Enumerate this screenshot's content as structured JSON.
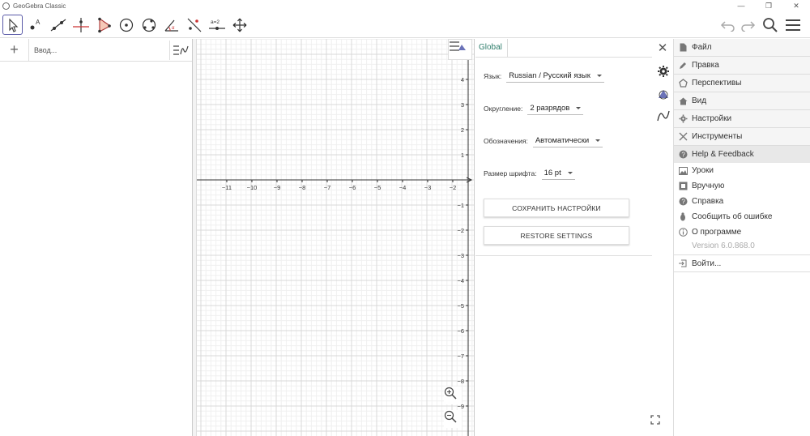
{
  "window": {
    "title": "GeoGebra Classic",
    "controls": [
      "—",
      "❐",
      "✕"
    ]
  },
  "algebra": {
    "placeholder": "Ввод..."
  },
  "graphics": {
    "x_ticks": [
      "-11",
      "-10",
      "-9",
      "-8",
      "-7",
      "-6",
      "-5",
      "-4",
      "-3",
      "-2"
    ],
    "y_ticks": [
      "4",
      "3",
      "2",
      "1",
      "-1",
      "-2",
      "-3",
      "-4",
      "-5",
      "-6",
      "-7",
      "-8",
      "-9"
    ]
  },
  "settings": {
    "tab": "Global",
    "language_label": "Язык:",
    "language_value": "Russian / Русский язык",
    "rounding_label": "Округление:",
    "rounding_value": "2 разрядов",
    "labeling_label": "Обозначения:",
    "labeling_value": "Автоматически",
    "fontsize_label": "Размер шрифта:",
    "fontsize_value": "16 pt",
    "save_button": "СОХРАНИТЬ НАСТРОЙКИ",
    "restore_button": "RESTORE SETTINGS"
  },
  "menu": {
    "items": [
      {
        "label": "Файл",
        "icon": "file-icon"
      },
      {
        "label": "Правка",
        "icon": "pencil-icon"
      },
      {
        "label": "Перспективы",
        "icon": "perspectives-icon"
      },
      {
        "label": "Вид",
        "icon": "home-icon"
      },
      {
        "label": "Настройки",
        "icon": "gear-icon"
      },
      {
        "label": "Инструменты",
        "icon": "tools-icon"
      },
      {
        "label": "Help & Feedback",
        "icon": "help-icon"
      }
    ],
    "help_items": [
      {
        "label": "Уроки",
        "icon": "image-icon"
      },
      {
        "label": "Вручную",
        "icon": "manual-icon"
      },
      {
        "label": "Справка",
        "icon": "question-icon"
      },
      {
        "label": "Сообщить об ошибке",
        "icon": "bug-icon"
      },
      {
        "label": "О программе",
        "icon": "info-icon"
      }
    ],
    "version": "Version 6.0.868.0",
    "login": "Войти..."
  }
}
